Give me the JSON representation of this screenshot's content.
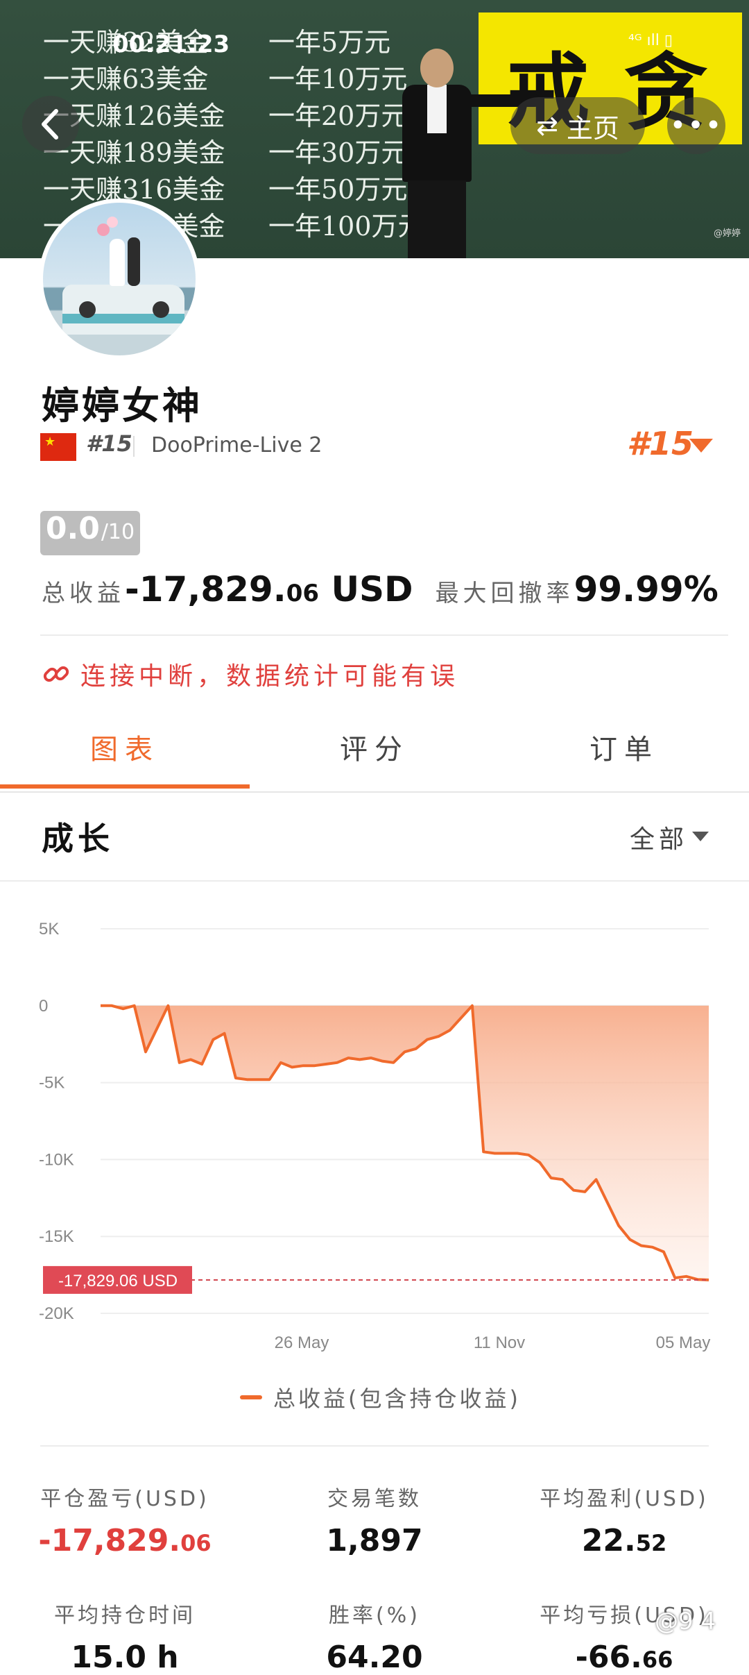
{
  "status_bar": {
    "time": "00:21:23",
    "icons": "⁴ᴳ ıll ▯"
  },
  "banner": {
    "rows": [
      [
        "一天赚32美金",
        "一年5万元"
      ],
      [
        "一天赚63美金",
        "一年10万元"
      ],
      [
        "一天赚126美金",
        "一年20万元"
      ],
      [
        "一天赚189美金",
        "一年30万元"
      ],
      [
        "一天赚316美金",
        "一年50万元"
      ],
      [
        "一天赚632美金",
        "一年100万元"
      ]
    ],
    "sign_char_1": "戒",
    "sign_char_2": "贪",
    "watermark": "@婷婷",
    "home_label": "主页",
    "home_icon": "⇄",
    "back_icon": "‹",
    "more_icon": "•••"
  },
  "profile": {
    "name": "婷婷女神",
    "rank_small": "#15",
    "server": "DooPrime-Live 2",
    "rank_big": "#15"
  },
  "score": {
    "value": "0.0",
    "max": "/10"
  },
  "summary": {
    "total_label": "总收益",
    "total_main": "-17,829.",
    "total_cents": "06",
    "total_unit": " USD",
    "drawdown_label": "最大回撤率",
    "drawdown_value": "99.99%"
  },
  "warning": {
    "text": "连接中断，数据统计可能有误"
  },
  "tabs": [
    {
      "label": "图表",
      "active": true
    },
    {
      "label": "评分",
      "active": false
    },
    {
      "label": "订单",
      "active": false
    }
  ],
  "section": {
    "title": "成长",
    "filter": "全部"
  },
  "chart_data": {
    "type": "area",
    "y_ticks": [
      "5K",
      "0",
      "-5K",
      "-10K",
      "-15K",
      "-20K"
    ],
    "ylim": [
      -20000,
      5000
    ],
    "x_ticks": [
      "26 May",
      "11 Nov",
      "05 May"
    ],
    "marker_label": "-17,829.06 USD",
    "marker_value": -17829.06,
    "series": [
      {
        "name": "总收益(包含持仓收益)",
        "color": "#f06a2c",
        "values": [
          0,
          0,
          -200,
          0,
          -3000,
          -1500,
          0,
          -3700,
          -3500,
          -3800,
          -2200,
          -1800,
          -4700,
          -4800,
          -4800,
          -4800,
          -3700,
          -4000,
          -3900,
          -3900,
          -3800,
          -3700,
          -3400,
          -3500,
          -3400,
          -3600,
          -3700,
          -3000,
          -2800,
          -2200,
          -2000,
          -1600,
          -800,
          0,
          -9500,
          -9600,
          -9600,
          -9600,
          -9700,
          -10200,
          -11200,
          -11300,
          -12000,
          -12100,
          -11300,
          -12800,
          -14300,
          -15200,
          -15600,
          -15700,
          -16000,
          -17700,
          -17600,
          -17800,
          -17829.06
        ]
      }
    ]
  },
  "bottom_stats": [
    {
      "label": "平仓盈亏(USD)",
      "value": "-17,829.",
      "cents": "06",
      "red": true
    },
    {
      "label": "交易笔数",
      "value": "1,897",
      "cents": "",
      "red": false
    },
    {
      "label": "平均盈利(USD)",
      "value": "22.",
      "cents": "52",
      "red": false
    },
    {
      "label": "平均持仓时间",
      "value": "15.0 h",
      "cents": "",
      "red": false
    },
    {
      "label": "胜率(%)",
      "value": "64.20",
      "cents": "",
      "red": false
    },
    {
      "label": "平均亏损(USD)",
      "value": "-66.",
      "cents": "66",
      "red": false
    }
  ],
  "corner_mark": "@9 4"
}
